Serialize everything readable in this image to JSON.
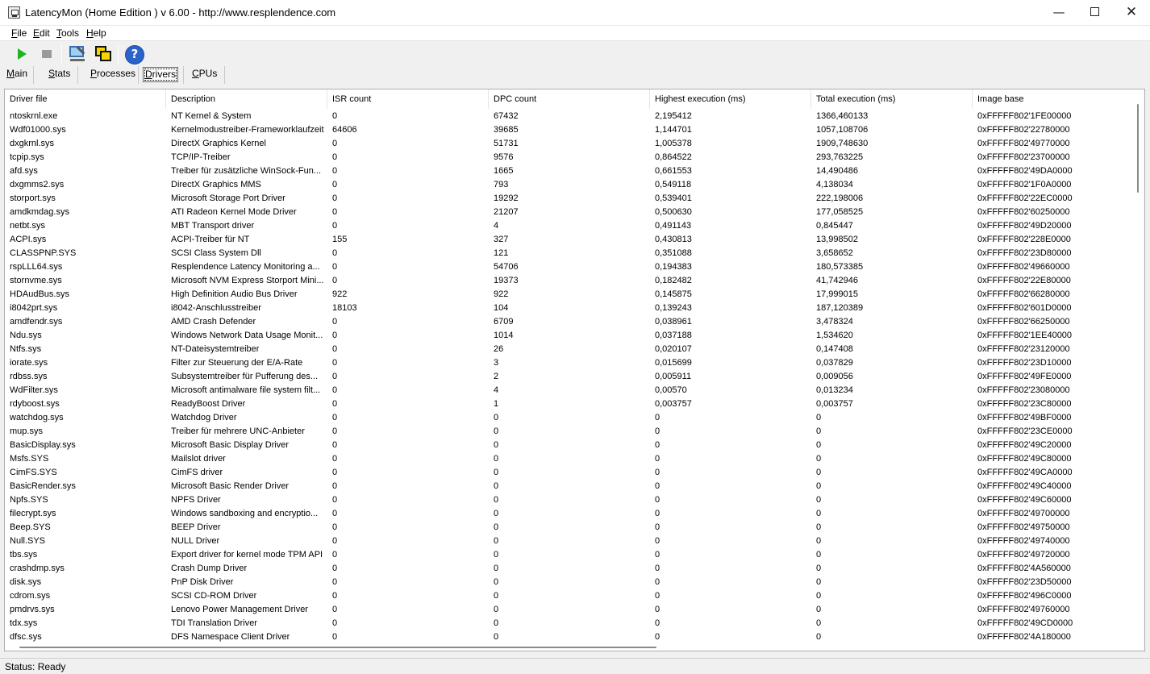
{
  "window": {
    "title": "LatencyMon  (Home Edition )  v 6.00 - http://www.resplendence.com",
    "icon": "latencymon-app-icon"
  },
  "menu": [
    {
      "label": "File",
      "accel": "F",
      "rest": "ile"
    },
    {
      "label": "Edit",
      "accel": "E",
      "rest": "dit"
    },
    {
      "label": "Tools",
      "accel": "T",
      "rest": "ools"
    },
    {
      "label": "Help",
      "accel": "H",
      "rest": "elp"
    }
  ],
  "toolbar": {
    "icons": [
      "play-icon",
      "stop-icon",
      "settings-wrench-icon",
      "windows-icon",
      "help-icon"
    ]
  },
  "tabs": [
    {
      "label": "Main",
      "accel": "M",
      "rest": "ain",
      "active": false
    },
    {
      "label": "Stats",
      "accel": "S",
      "rest": "tats",
      "active": false
    },
    {
      "label": "Processes",
      "accel": "P",
      "rest": "rocesses",
      "active": false
    },
    {
      "label": "Drivers",
      "accel": "D",
      "rest": "rivers",
      "active": true
    },
    {
      "label": "CPUs",
      "accel": "C",
      "rest": "PUs",
      "active": false
    }
  ],
  "table": {
    "columns": [
      "Driver file",
      "Description",
      "ISR count",
      "DPC count",
      "Highest execution (ms)",
      "Total execution (ms)",
      "Image base"
    ],
    "rows": [
      [
        "ntoskrnl.exe",
        "NT Kernel & System",
        "0",
        "67432",
        "2,195412",
        "1366,460133",
        "0xFFFFF802'1FE00000"
      ],
      [
        "Wdf01000.sys",
        "Kernelmodustreiber-Frameworklaufzeit",
        "64606",
        "39685",
        "1,144701",
        "1057,108706",
        "0xFFFFF802'22780000"
      ],
      [
        "dxgkrnl.sys",
        "DirectX Graphics Kernel",
        "0",
        "51731",
        "1,005378",
        "1909,748630",
        "0xFFFFF802'49770000"
      ],
      [
        "tcpip.sys",
        "TCP/IP-Treiber",
        "0",
        "9576",
        "0,864522",
        "293,763225",
        "0xFFFFF802'23700000"
      ],
      [
        "afd.sys",
        "Treiber für zusätzliche WinSock-Fun...",
        "0",
        "1665",
        "0,661553",
        "14,490486",
        "0xFFFFF802'49DA0000"
      ],
      [
        "dxgmms2.sys",
        "DirectX Graphics MMS",
        "0",
        "793",
        "0,549118",
        "4,138034",
        "0xFFFFF802'1F0A0000"
      ],
      [
        "storport.sys",
        "Microsoft Storage Port Driver",
        "0",
        "19292",
        "0,539401",
        "222,198006",
        "0xFFFFF802'22EC0000"
      ],
      [
        "amdkmdag.sys",
        "ATI Radeon Kernel Mode Driver",
        "0",
        "21207",
        "0,500630",
        "177,058525",
        "0xFFFFF802'60250000"
      ],
      [
        "netbt.sys",
        "MBT Transport driver",
        "0",
        "4",
        "0,491143",
        "0,845447",
        "0xFFFFF802'49D20000"
      ],
      [
        "ACPI.sys",
        "ACPI-Treiber für NT",
        "155",
        "327",
        "0,430813",
        "13,998502",
        "0xFFFFF802'228E0000"
      ],
      [
        "CLASSPNP.SYS",
        "SCSI Class System Dll",
        "0",
        "121",
        "0,351088",
        "3,658652",
        "0xFFFFF802'23D80000"
      ],
      [
        "rspLLL64.sys",
        "Resplendence Latency Monitoring a...",
        "0",
        "54706",
        "0,194383",
        "180,573385",
        "0xFFFFF802'49660000"
      ],
      [
        "stornvme.sys",
        "Microsoft NVM Express Storport Mini...",
        "0",
        "19373",
        "0,182482",
        "41,742946",
        "0xFFFFF802'22E80000"
      ],
      [
        "HDAudBus.sys",
        "High Definition Audio Bus Driver",
        "922",
        "922",
        "0,145875",
        "17,999015",
        "0xFFFFF802'66280000"
      ],
      [
        "i8042prt.sys",
        "i8042-Anschlusstreiber",
        "18103",
        "104",
        "0,139243",
        "187,120389",
        "0xFFFFF802'601D0000"
      ],
      [
        "amdfendr.sys",
        "AMD Crash Defender",
        "0",
        "6709",
        "0,038961",
        "3,478324",
        "0xFFFFF802'66250000"
      ],
      [
        "Ndu.sys",
        "Windows Network Data Usage Monit...",
        "0",
        "1014",
        "0,037188",
        "1,534620",
        "0xFFFFF802'1EE40000"
      ],
      [
        "Ntfs.sys",
        "NT-Dateisystemtreiber",
        "0",
        "26",
        "0,020107",
        "0,147408",
        "0xFFFFF802'23120000"
      ],
      [
        "iorate.sys",
        "Filter zur Steuerung der E/A-Rate",
        "0",
        "3",
        "0,015699",
        "0,037829",
        "0xFFFFF802'23D10000"
      ],
      [
        "rdbss.sys",
        "Subsystemtreiber für Pufferung des...",
        "0",
        "2",
        "0,005911",
        "0,009056",
        "0xFFFFF802'49FE0000"
      ],
      [
        "WdFilter.sys",
        "Microsoft antimalware file system filt...",
        "0",
        "4",
        "0,00570",
        "0,013234",
        "0xFFFFF802'23080000"
      ],
      [
        "rdyboost.sys",
        "ReadyBoost Driver",
        "0",
        "1",
        "0,003757",
        "0,003757",
        "0xFFFFF802'23C80000"
      ],
      [
        "watchdog.sys",
        "Watchdog Driver",
        "0",
        "0",
        "0",
        "0",
        "0xFFFFF802'49BF0000"
      ],
      [
        "mup.sys",
        "Treiber für mehrere UNC-Anbieter",
        "0",
        "0",
        "0",
        "0",
        "0xFFFFF802'23CE0000"
      ],
      [
        "BasicDisplay.sys",
        "Microsoft Basic Display Driver",
        "0",
        "0",
        "0",
        "0",
        "0xFFFFF802'49C20000"
      ],
      [
        "Msfs.SYS",
        "Mailslot driver",
        "0",
        "0",
        "0",
        "0",
        "0xFFFFF802'49C80000"
      ],
      [
        "CimFS.SYS",
        "CimFS driver",
        "0",
        "0",
        "0",
        "0",
        "0xFFFFF802'49CA0000"
      ],
      [
        "BasicRender.sys",
        "Microsoft Basic Render Driver",
        "0",
        "0",
        "0",
        "0",
        "0xFFFFF802'49C40000"
      ],
      [
        "Npfs.SYS",
        "NPFS Driver",
        "0",
        "0",
        "0",
        "0",
        "0xFFFFF802'49C60000"
      ],
      [
        "filecrypt.sys",
        "Windows sandboxing and encryptio...",
        "0",
        "0",
        "0",
        "0",
        "0xFFFFF802'49700000"
      ],
      [
        "Beep.SYS",
        "BEEP Driver",
        "0",
        "0",
        "0",
        "0",
        "0xFFFFF802'49750000"
      ],
      [
        "Null.SYS",
        "NULL Driver",
        "0",
        "0",
        "0",
        "0",
        "0xFFFFF802'49740000"
      ],
      [
        "tbs.sys",
        "Export driver for kernel mode TPM API",
        "0",
        "0",
        "0",
        "0",
        "0xFFFFF802'49720000"
      ],
      [
        "crashdmp.sys",
        "Crash Dump Driver",
        "0",
        "0",
        "0",
        "0",
        "0xFFFFF802'4A560000"
      ],
      [
        "disk.sys",
        "PnP Disk Driver",
        "0",
        "0",
        "0",
        "0",
        "0xFFFFF802'23D50000"
      ],
      [
        "cdrom.sys",
        "SCSI CD-ROM Driver",
        "0",
        "0",
        "0",
        "0",
        "0xFFFFF802'496C0000"
      ],
      [
        "pmdrvs.sys",
        "Lenovo Power Management Driver",
        "0",
        "0",
        "0",
        "0",
        "0xFFFFF802'49760000"
      ],
      [
        "tdx.sys",
        "TDI Translation Driver",
        "0",
        "0",
        "0",
        "0",
        "0xFFFFF802'49CD0000"
      ],
      [
        "dfsc.sys",
        "DFS Namespace Client Driver",
        "0",
        "0",
        "0",
        "0",
        "0xFFFFF802'4A180000"
      ]
    ]
  },
  "status": {
    "text": "Status: Ready"
  }
}
